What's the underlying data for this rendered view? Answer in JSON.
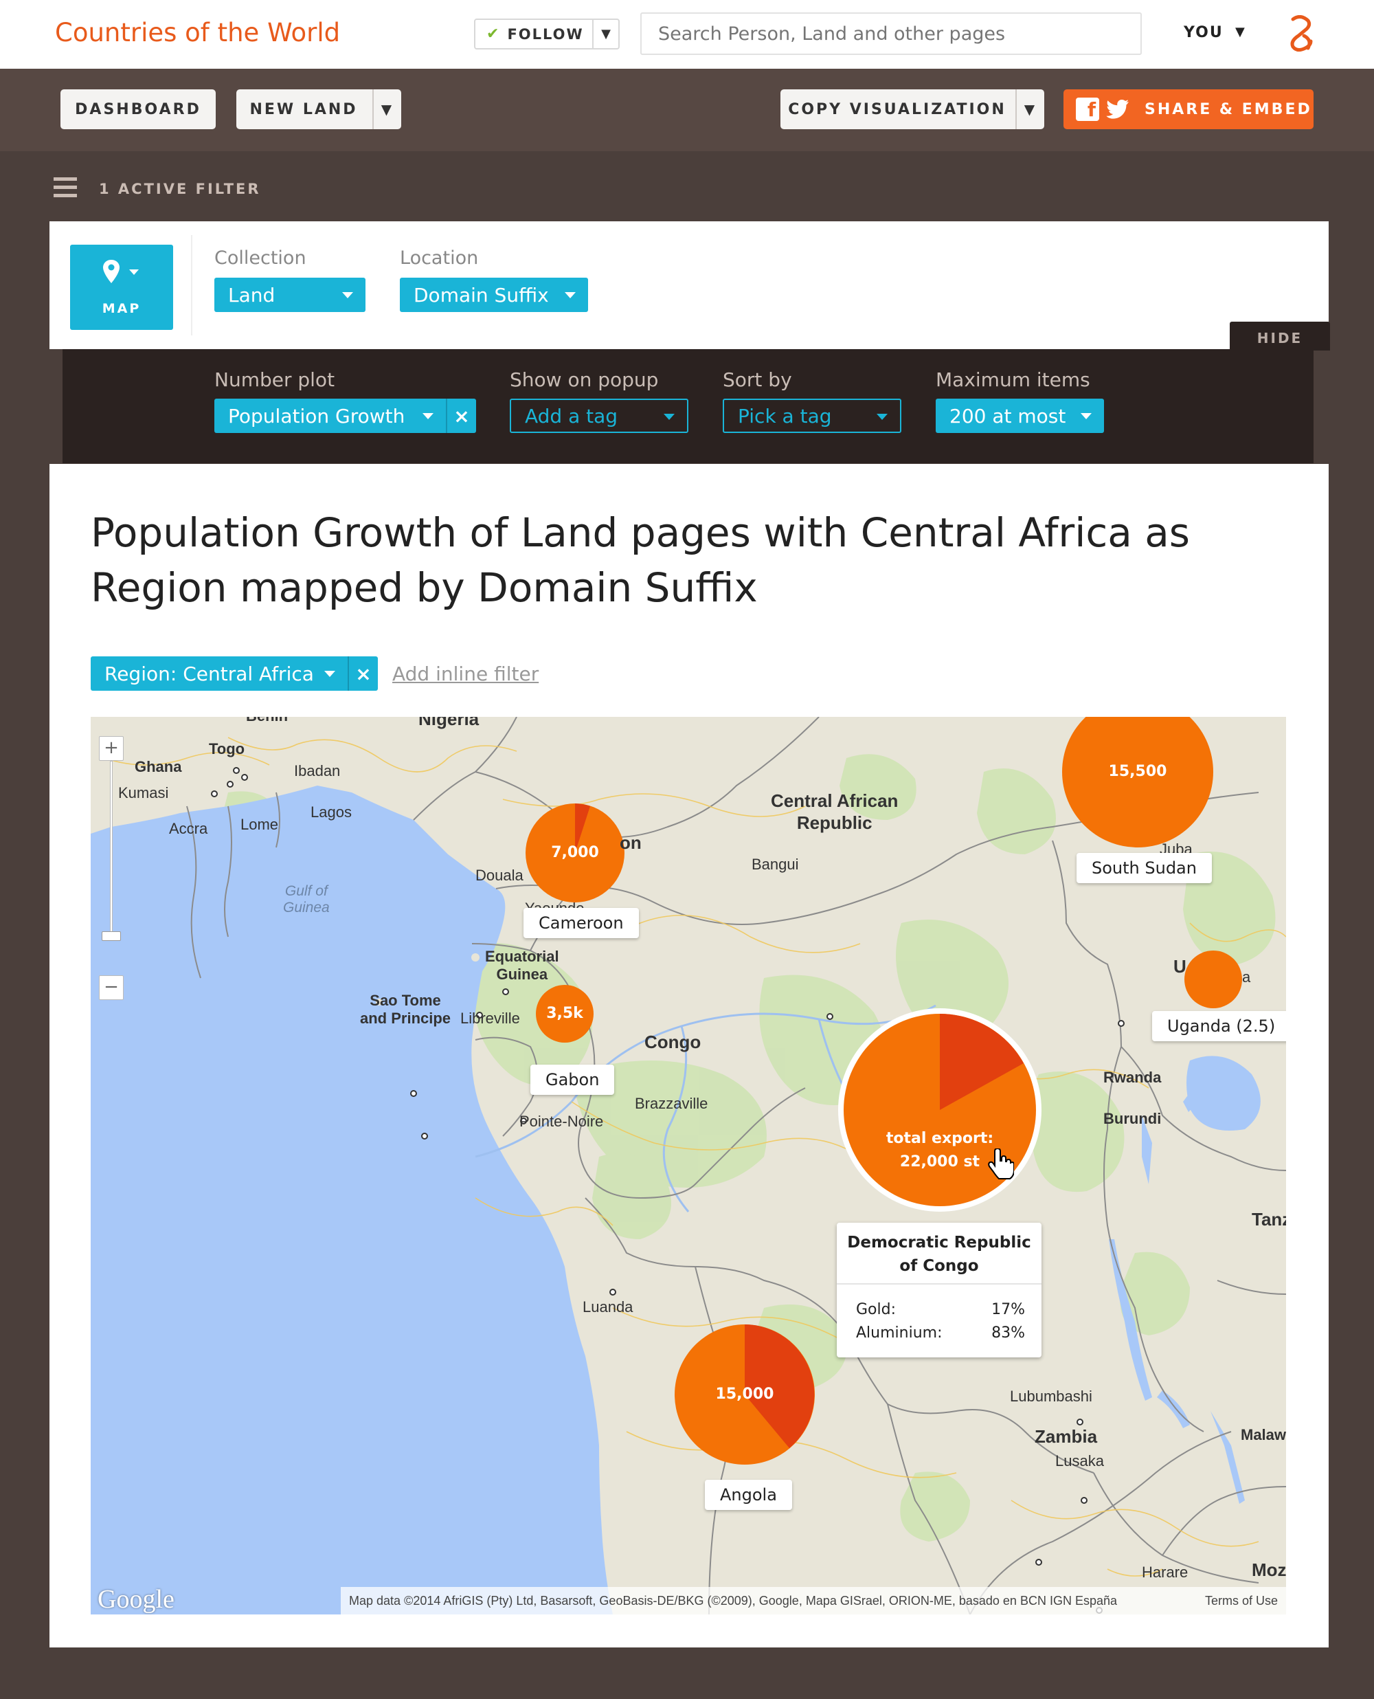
{
  "header": {
    "brand": "Countries of the World",
    "follow_label": "FOLLOW",
    "search_placeholder": "Search Person, Land and other pages",
    "user_label": "YOU"
  },
  "toolbar": {
    "dashboard": "DASHBOARD",
    "new_land": "NEW LAND",
    "copy_viz": "COPY VISUALIZATION",
    "share": "SHARE & EMBED"
  },
  "filters": {
    "active_filter": "1 ACTIVE FILTER"
  },
  "config": {
    "view_label": "MAP",
    "collection_label": "Collection",
    "collection_value": "Land",
    "location_label": "Location",
    "location_value": "Domain Suffix",
    "hide_label": "HIDE",
    "number_plot_label": "Number plot",
    "number_plot_value": "Population Growth",
    "popup_label": "Show on popup",
    "popup_value": "Add a tag",
    "sort_label": "Sort by",
    "sort_value": "Pick a tag",
    "max_label": "Maximum items",
    "max_value": "200 at most"
  },
  "main": {
    "title": "Population Growth of Land pages with Central Africa as Region mapped by Domain Suffix",
    "inline_filter": "Region: Central Africa",
    "add_inline_filter": "Add inline filter"
  },
  "map": {
    "labels": {
      "nigeria": "Nigeria",
      "benin": "Benin",
      "togo": "Togo",
      "ghana": "Ghana",
      "kumasi": "Kumasi",
      "accra": "Accra",
      "lome": "Lome",
      "ibadan": "Ibadan",
      "lagos": "Lagos",
      "gulf": "Gulf of\nGuinea",
      "douala": "Douala",
      "yaounde": "Yaounde",
      "eq_guinea": "Equatorial\nGuinea",
      "sao_tome": "Sao Tome\nand Principe",
      "libreville": "Libreville",
      "congo": "Congo",
      "car": "Central African\nRepublic",
      "bangui": "Bangui",
      "juba": "Juba",
      "rwanda": "Rwanda",
      "burundi": "Burundi",
      "tanzania": "Tanz",
      "brazzaville": "Brazzaville",
      "pointe_noire": "Pointe-Noire",
      "luanda": "Luanda",
      "lubumbashi": "Lubumbashi",
      "zambia": "Zambia",
      "malawi": "Malaw",
      "lusaka": "Lusaka",
      "harare": "Harare",
      "mozambique": "Moz",
      "uganda_u": "U",
      "uganda_a": "a",
      "cameroon_on": "on"
    },
    "markers": [
      {
        "name": "Cameroon",
        "value": "7,000",
        "slice_pct": 5
      },
      {
        "name": "South Sudan",
        "value": "15,500",
        "slice_pct": 0
      },
      {
        "name": "Gabon",
        "value": "3,5k",
        "slice_pct": 0
      },
      {
        "name": "Uganda (2.5)",
        "value": "",
        "slice_pct": 0
      },
      {
        "name": "Democratic Republic of Congo",
        "value_line1": "total export:",
        "value_line2": "22,000 st",
        "slice_pct": 17
      },
      {
        "name": "Angola",
        "value": "15,000",
        "slice_pct": 39
      }
    ],
    "popup": {
      "title": "Democratic Republic\nof Congo",
      "rows": [
        {
          "label": "Gold:",
          "value": "17%"
        },
        {
          "label": "Aluminium:",
          "value": "83%"
        }
      ]
    },
    "zoom_in": "+",
    "zoom_out": "−",
    "google": "Google",
    "attribution": "Map data ©2014 AfriGIS (Pty) Ltd, Basarsoft, GeoBasis-DE/BKG (©2009), Google, Mapa GISrael, ORION-ME, basado en BCN IGN España",
    "terms": "Terms of Use"
  },
  "colors": {
    "brand": "#e85a1b",
    "accent": "#1ab4d7",
    "bubble": "#f47206",
    "bubble_slice": "#e2400f",
    "share": "#f26522"
  }
}
